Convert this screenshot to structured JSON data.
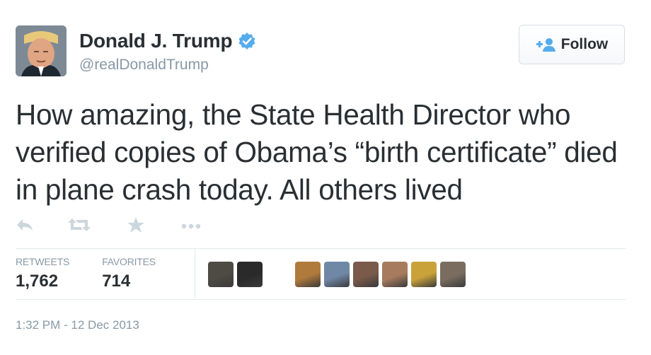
{
  "user": {
    "display_name": "Donald J. Trump",
    "handle": "@realDonaldTrump",
    "avatar_icon": "profile-photo",
    "verified_icon": "verified-badge-icon"
  },
  "follow_button": {
    "label": "Follow",
    "icon": "add-user-icon"
  },
  "tweet": {
    "text": "How amazing, the State Health Director who verified copies of Obama’s “birth certificate” died in plane crash today. All others lived"
  },
  "actions": {
    "icons": [
      "reply-icon",
      "retweet-icon",
      "favorite-icon",
      "more-icon"
    ]
  },
  "stats": {
    "retweets_label": "RETWEETS",
    "retweets_value": "1,762",
    "favorites_label": "FAVORITES",
    "favorites_value": "714"
  },
  "favoriters": {
    "avatar_colors": [
      "#4d4b44",
      "#2a2a2a",
      "#ffffff",
      "#b07a3c",
      "#6f88a6",
      "#7a5a4a",
      "#a77c5e",
      "#c9a23a",
      "#7a6d60"
    ]
  },
  "timestamp": "1:32 PM - 12 Dec 2013",
  "colors": {
    "text": "#292f33",
    "muted": "#8899a6",
    "verified": "#55acee",
    "icon": "#ccd6dd",
    "divider": "#e1e8ed"
  }
}
